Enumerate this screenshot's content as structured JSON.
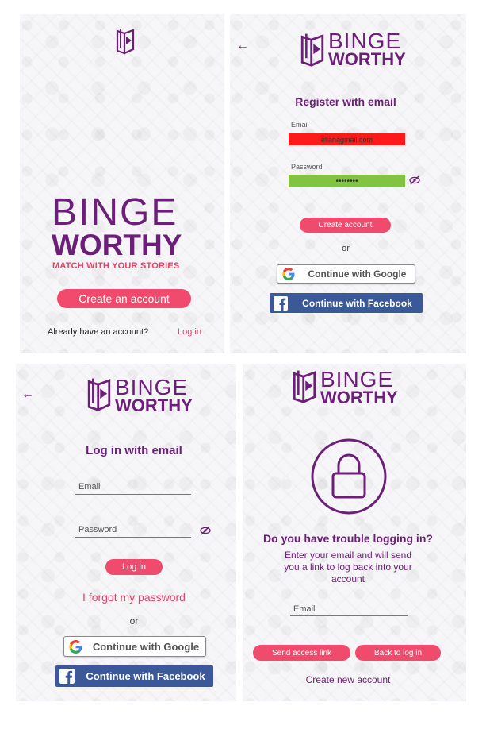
{
  "logo": {
    "binge": "BINGE",
    "worthy": "WORTHY"
  },
  "welcome": {
    "tagline": "MATCH WITH YOUR STORIES",
    "create_account": "Create an account",
    "have_account": "Already have an account?",
    "login_link": "Log in"
  },
  "register": {
    "title": "Register with email",
    "email_label": "Email",
    "email_value": "elianagmail.com",
    "password_label": "Password",
    "password_value": "••••••••",
    "submit": "Create account",
    "or": "or",
    "google": "Continue with Google",
    "facebook": "Continue with Facebook",
    "email_error_color": "#ff1a1a",
    "password_ok_color": "#82c341"
  },
  "login": {
    "title": "Log in with email",
    "email_placeholder": "Email",
    "password_placeholder": "Password",
    "submit": "Log in",
    "forgot": "I forgot my password",
    "or": "or",
    "google": "Continue with Google",
    "facebook": "Continue with Facebook"
  },
  "trouble": {
    "title": "Do you have trouble logging in?",
    "description": "Enter your email and will send you a link to log back into your account",
    "email_placeholder": "Email",
    "send_link": "Send access link",
    "back_login": "Back to log in",
    "create_new": "Create new account"
  },
  "colors": {
    "brand_purple": "#6c1f78",
    "accent_pink": "#f04b6d",
    "facebook_blue": "#3b5998"
  },
  "icons": [
    "book-play-logo-icon",
    "back-arrow-icon",
    "eye-slash-icon",
    "google-g-icon",
    "facebook-f-icon",
    "padlock-icon"
  ]
}
